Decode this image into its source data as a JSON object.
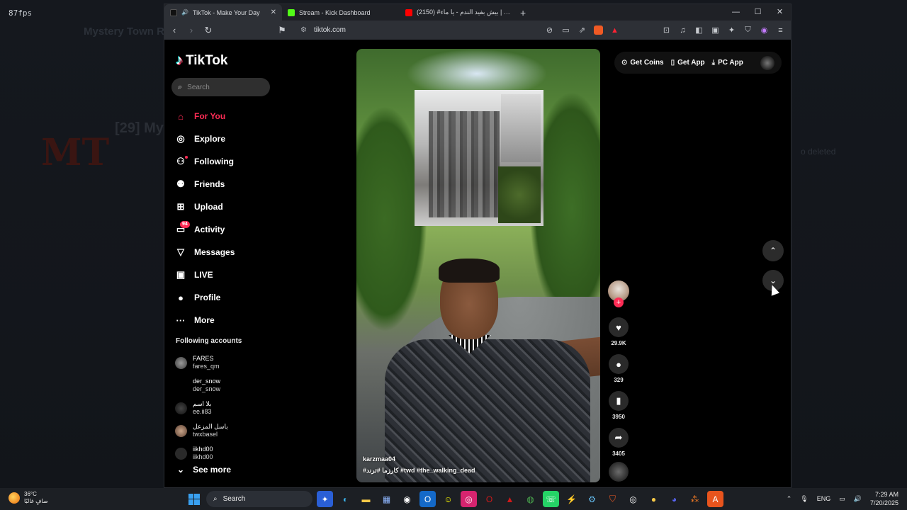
{
  "overlay": {
    "fps": "87fps"
  },
  "background": {
    "title": "Mystery Town R",
    "num": "[29] My",
    "logo": "MT",
    "right_text": "o deleted"
  },
  "browser": {
    "tabs": [
      {
        "title": "TikTok - Make Your Day",
        "color": "#ffffff",
        "active": true
      },
      {
        "title": "Stream - Kick Dashboard",
        "color": "#53fc18",
        "active": false
      },
      {
        "title": "(2150) #سورية | بيش بفيد الندم - يا ماء",
        "color": "#ff0000",
        "active": false
      }
    ],
    "url": "tiktok.com",
    "window_controls": [
      "—",
      "☐",
      "✕"
    ]
  },
  "tiktok": {
    "logo_text": "TikTok",
    "search_placeholder": "Search",
    "nav": [
      {
        "label": "For You",
        "icon": "home-icon",
        "glyph": "⌂",
        "active": true
      },
      {
        "label": "Explore",
        "icon": "compass-icon",
        "glyph": "◎"
      },
      {
        "label": "Following",
        "icon": "following-icon",
        "glyph": "⚇"
      },
      {
        "label": "Friends",
        "icon": "friends-icon",
        "glyph": "⚉"
      },
      {
        "label": "Upload",
        "icon": "upload-icon",
        "glyph": "⊞"
      },
      {
        "label": "Activity",
        "icon": "activity-icon",
        "glyph": "▭",
        "badge": "94"
      },
      {
        "label": "Messages",
        "icon": "messages-icon",
        "glyph": "▽"
      },
      {
        "label": "LIVE",
        "icon": "live-icon",
        "glyph": "▣"
      },
      {
        "label": "Profile",
        "icon": "profile-icon",
        "glyph": "●"
      },
      {
        "label": "More",
        "icon": "more-icon",
        "glyph": "···"
      }
    ],
    "following_title": "Following accounts",
    "following": [
      {
        "name": "FARES",
        "user": "fares_qm"
      },
      {
        "name": "der_snow",
        "user": "der_snow"
      },
      {
        "name": "بلا اسم",
        "user": "ee.ii83"
      },
      {
        "name": "باسل المزعل",
        "user": "twxbasel"
      },
      {
        "name": "iikhd00",
        "user": "iikhd00"
      }
    ],
    "see_more": "See more",
    "video": {
      "username": "karzmaa04",
      "tags": "#كارزما #ترند #twd #the_walking_dead"
    },
    "actions": {
      "likes": "29.9K",
      "comments": "329",
      "saves": "3950",
      "shares": "3405"
    },
    "top_buttons": [
      {
        "label": "Get Coins",
        "icon": "coin-icon",
        "glyph": "⊙"
      },
      {
        "label": "Get App",
        "icon": "phone-icon",
        "glyph": "▯"
      },
      {
        "label": "PC App",
        "icon": "download-icon",
        "glyph": "⤓"
      }
    ]
  },
  "taskbar": {
    "weather_temp": "36°C",
    "weather_desc": "صافٍ غالبًا",
    "search": "Search",
    "lang": "ENG",
    "time": "7:29 AM",
    "date": "7/20/2025"
  }
}
